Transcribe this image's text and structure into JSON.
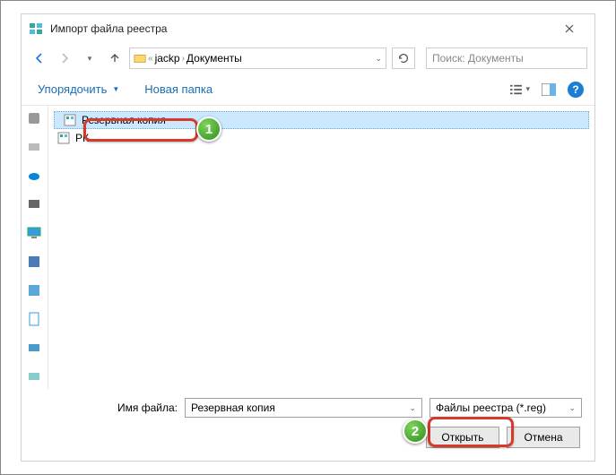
{
  "window": {
    "title": "Импорт файла реестра"
  },
  "nav": {
    "path1": "jackp",
    "path2": "Документы",
    "search_placeholder": "Поиск: Документы"
  },
  "toolbar": {
    "organize": "Упорядочить",
    "new_folder": "Новая папка"
  },
  "files": {
    "f1": "Резервная копия",
    "f2": "РК"
  },
  "footer": {
    "filename_label": "Имя файла:",
    "filename_value": "Резервная копия",
    "filetype_value": "Файлы реестра (*.reg)",
    "open": "Открыть",
    "cancel": "Отмена"
  },
  "badges": {
    "b1": "1",
    "b2": "2"
  }
}
